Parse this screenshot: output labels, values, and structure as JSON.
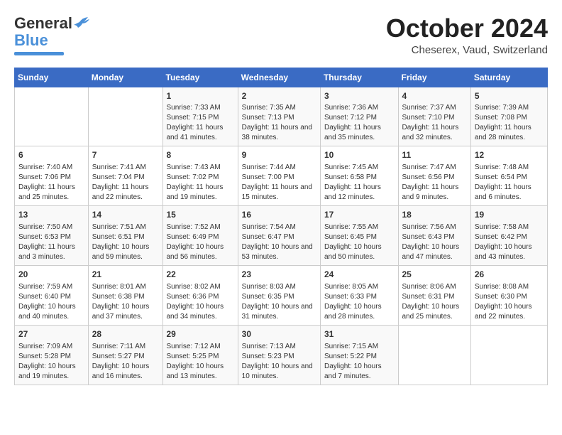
{
  "header": {
    "logo_general": "General",
    "logo_blue": "Blue",
    "title": "October 2024",
    "location": "Cheserex, Vaud, Switzerland"
  },
  "days_of_week": [
    "Sunday",
    "Monday",
    "Tuesday",
    "Wednesday",
    "Thursday",
    "Friday",
    "Saturday"
  ],
  "weeks": [
    [
      {
        "day": null,
        "info": null
      },
      {
        "day": null,
        "info": null
      },
      {
        "day": "1",
        "info": "Sunrise: 7:33 AM\nSunset: 7:15 PM\nDaylight: 11 hours and 41 minutes."
      },
      {
        "day": "2",
        "info": "Sunrise: 7:35 AM\nSunset: 7:13 PM\nDaylight: 11 hours and 38 minutes."
      },
      {
        "day": "3",
        "info": "Sunrise: 7:36 AM\nSunset: 7:12 PM\nDaylight: 11 hours and 35 minutes."
      },
      {
        "day": "4",
        "info": "Sunrise: 7:37 AM\nSunset: 7:10 PM\nDaylight: 11 hours and 32 minutes."
      },
      {
        "day": "5",
        "info": "Sunrise: 7:39 AM\nSunset: 7:08 PM\nDaylight: 11 hours and 28 minutes."
      }
    ],
    [
      {
        "day": "6",
        "info": "Sunrise: 7:40 AM\nSunset: 7:06 PM\nDaylight: 11 hours and 25 minutes."
      },
      {
        "day": "7",
        "info": "Sunrise: 7:41 AM\nSunset: 7:04 PM\nDaylight: 11 hours and 22 minutes."
      },
      {
        "day": "8",
        "info": "Sunrise: 7:43 AM\nSunset: 7:02 PM\nDaylight: 11 hours and 19 minutes."
      },
      {
        "day": "9",
        "info": "Sunrise: 7:44 AM\nSunset: 7:00 PM\nDaylight: 11 hours and 15 minutes."
      },
      {
        "day": "10",
        "info": "Sunrise: 7:45 AM\nSunset: 6:58 PM\nDaylight: 11 hours and 12 minutes."
      },
      {
        "day": "11",
        "info": "Sunrise: 7:47 AM\nSunset: 6:56 PM\nDaylight: 11 hours and 9 minutes."
      },
      {
        "day": "12",
        "info": "Sunrise: 7:48 AM\nSunset: 6:54 PM\nDaylight: 11 hours and 6 minutes."
      }
    ],
    [
      {
        "day": "13",
        "info": "Sunrise: 7:50 AM\nSunset: 6:53 PM\nDaylight: 11 hours and 3 minutes."
      },
      {
        "day": "14",
        "info": "Sunrise: 7:51 AM\nSunset: 6:51 PM\nDaylight: 10 hours and 59 minutes."
      },
      {
        "day": "15",
        "info": "Sunrise: 7:52 AM\nSunset: 6:49 PM\nDaylight: 10 hours and 56 minutes."
      },
      {
        "day": "16",
        "info": "Sunrise: 7:54 AM\nSunset: 6:47 PM\nDaylight: 10 hours and 53 minutes."
      },
      {
        "day": "17",
        "info": "Sunrise: 7:55 AM\nSunset: 6:45 PM\nDaylight: 10 hours and 50 minutes."
      },
      {
        "day": "18",
        "info": "Sunrise: 7:56 AM\nSunset: 6:43 PM\nDaylight: 10 hours and 47 minutes."
      },
      {
        "day": "19",
        "info": "Sunrise: 7:58 AM\nSunset: 6:42 PM\nDaylight: 10 hours and 43 minutes."
      }
    ],
    [
      {
        "day": "20",
        "info": "Sunrise: 7:59 AM\nSunset: 6:40 PM\nDaylight: 10 hours and 40 minutes."
      },
      {
        "day": "21",
        "info": "Sunrise: 8:01 AM\nSunset: 6:38 PM\nDaylight: 10 hours and 37 minutes."
      },
      {
        "day": "22",
        "info": "Sunrise: 8:02 AM\nSunset: 6:36 PM\nDaylight: 10 hours and 34 minutes."
      },
      {
        "day": "23",
        "info": "Sunrise: 8:03 AM\nSunset: 6:35 PM\nDaylight: 10 hours and 31 minutes."
      },
      {
        "day": "24",
        "info": "Sunrise: 8:05 AM\nSunset: 6:33 PM\nDaylight: 10 hours and 28 minutes."
      },
      {
        "day": "25",
        "info": "Sunrise: 8:06 AM\nSunset: 6:31 PM\nDaylight: 10 hours and 25 minutes."
      },
      {
        "day": "26",
        "info": "Sunrise: 8:08 AM\nSunset: 6:30 PM\nDaylight: 10 hours and 22 minutes."
      }
    ],
    [
      {
        "day": "27",
        "info": "Sunrise: 7:09 AM\nSunset: 5:28 PM\nDaylight: 10 hours and 19 minutes."
      },
      {
        "day": "28",
        "info": "Sunrise: 7:11 AM\nSunset: 5:27 PM\nDaylight: 10 hours and 16 minutes."
      },
      {
        "day": "29",
        "info": "Sunrise: 7:12 AM\nSunset: 5:25 PM\nDaylight: 10 hours and 13 minutes."
      },
      {
        "day": "30",
        "info": "Sunrise: 7:13 AM\nSunset: 5:23 PM\nDaylight: 10 hours and 10 minutes."
      },
      {
        "day": "31",
        "info": "Sunrise: 7:15 AM\nSunset: 5:22 PM\nDaylight: 10 hours and 7 minutes."
      },
      {
        "day": null,
        "info": null
      },
      {
        "day": null,
        "info": null
      }
    ]
  ]
}
